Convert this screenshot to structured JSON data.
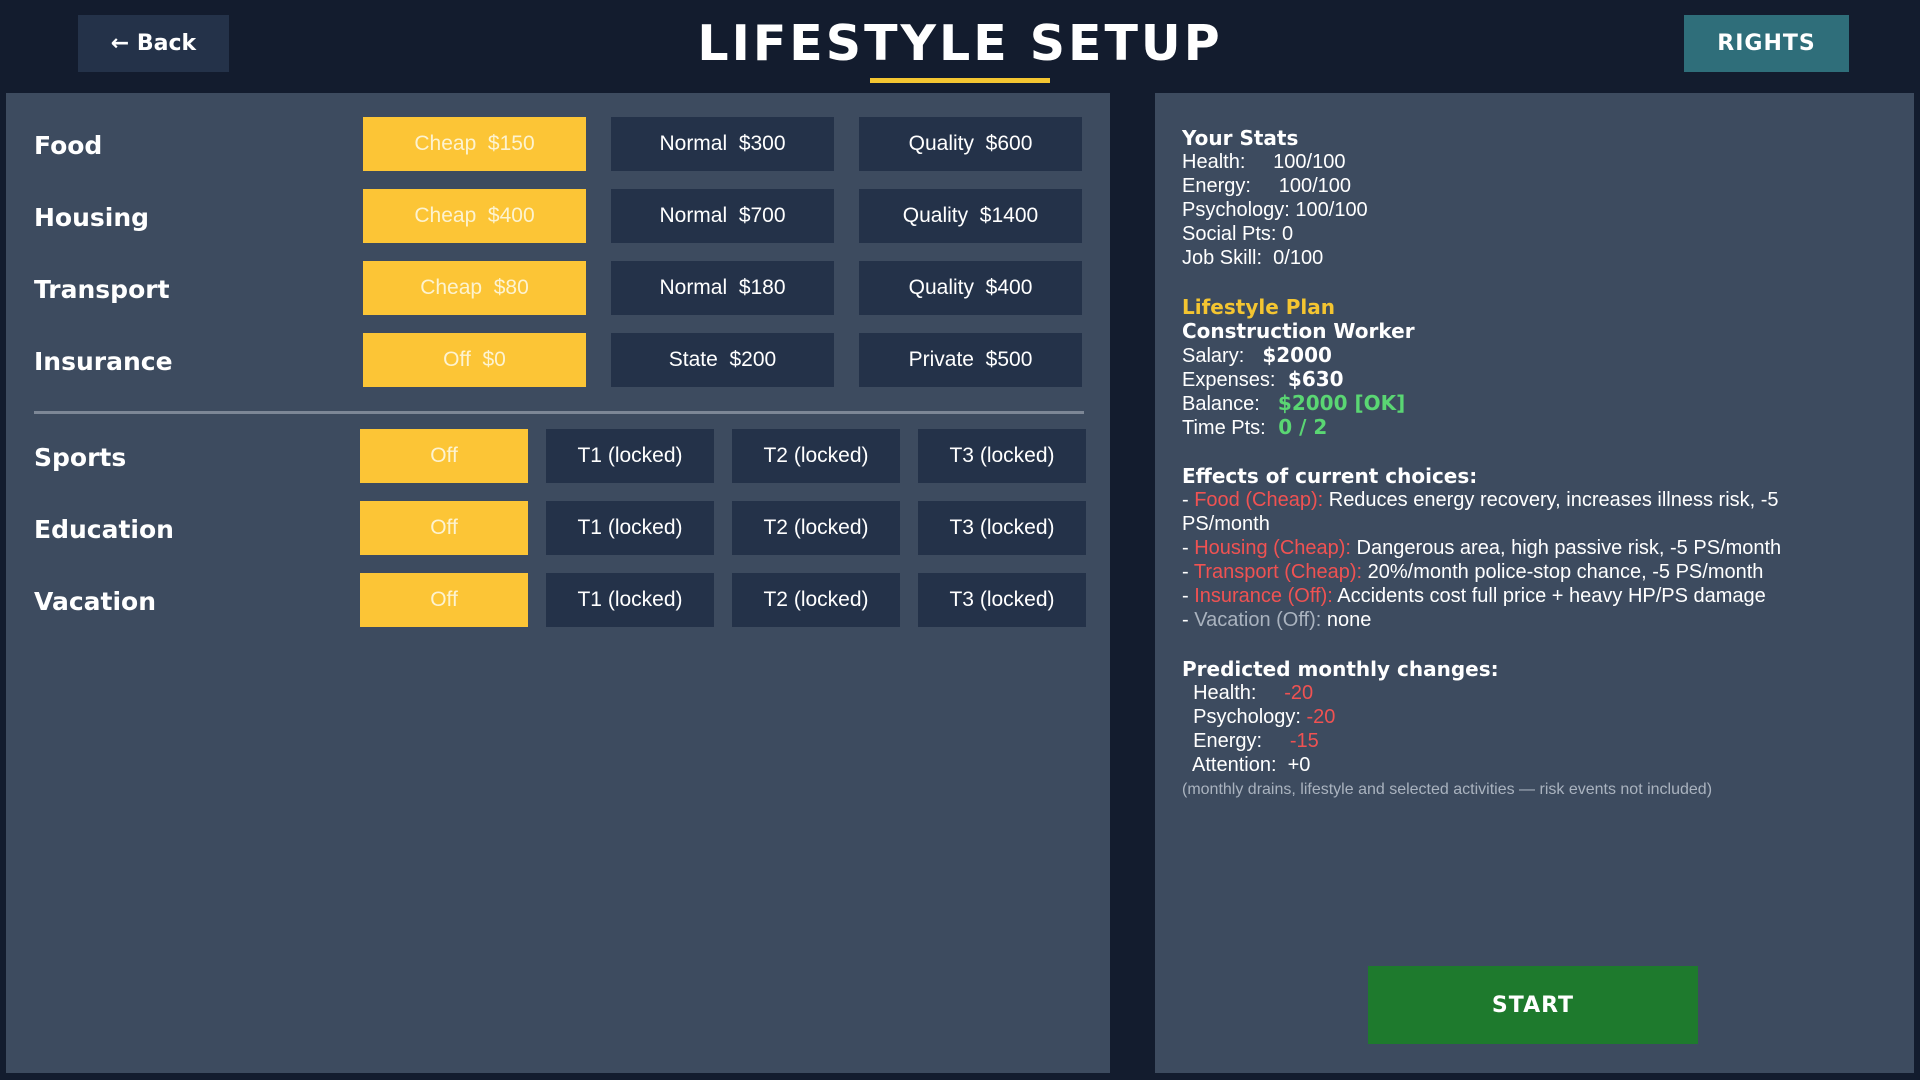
{
  "header": {
    "back_label": "← Back",
    "title": "LIFESTYLE SETUP",
    "rights_label": "RIGHTS"
  },
  "colors": {
    "background": "#131c2e",
    "panel": "#3d4b5f",
    "button": "#243249",
    "selected": "#fcc536",
    "accent": "#f4c531",
    "rights": "#2f6e7a",
    "start": "#1e7a2d",
    "negative": "#f05252",
    "positive": "#5ad673"
  },
  "lifestyle": {
    "food": {
      "label": "Food",
      "options": [
        {
          "label": "Cheap  $150",
          "selected": true
        },
        {
          "label": "Normal  $300",
          "selected": false
        },
        {
          "label": "Quality  $600",
          "selected": false
        }
      ]
    },
    "housing": {
      "label": "Housing",
      "options": [
        {
          "label": "Cheap  $400",
          "selected": true
        },
        {
          "label": "Normal  $700",
          "selected": false
        },
        {
          "label": "Quality  $1400",
          "selected": false
        }
      ]
    },
    "transport": {
      "label": "Transport",
      "options": [
        {
          "label": "Cheap  $80",
          "selected": true
        },
        {
          "label": "Normal  $180",
          "selected": false
        },
        {
          "label": "Quality  $400",
          "selected": false
        }
      ]
    },
    "insurance": {
      "label": "Insurance",
      "options": [
        {
          "label": "Off  $0",
          "selected": true
        },
        {
          "label": "State  $200",
          "selected": false
        },
        {
          "label": "Private  $500",
          "selected": false
        }
      ]
    }
  },
  "activities": {
    "sports": {
      "label": "Sports",
      "options": [
        {
          "label": "Off",
          "selected": true
        },
        {
          "label": "T1 (locked)",
          "selected": false
        },
        {
          "label": "T2 (locked)",
          "selected": false
        },
        {
          "label": "T3 (locked)",
          "selected": false
        }
      ]
    },
    "education": {
      "label": "Education",
      "options": [
        {
          "label": "Off",
          "selected": true
        },
        {
          "label": "T1 (locked)",
          "selected": false
        },
        {
          "label": "T2 (locked)",
          "selected": false
        },
        {
          "label": "T3 (locked)",
          "selected": false
        }
      ]
    },
    "vacation": {
      "label": "Vacation",
      "options": [
        {
          "label": "Off",
          "selected": true
        },
        {
          "label": "T1 (locked)",
          "selected": false
        },
        {
          "label": "T2 (locked)",
          "selected": false
        },
        {
          "label": "T3 (locked)",
          "selected": false
        }
      ]
    }
  },
  "stats": {
    "heading": "Your Stats",
    "health": "Health:     100/100",
    "energy": "Energy:     100/100",
    "psychology": "Psychology: 100/100",
    "social": "Social Pts: 0",
    "job_skill": "Job Skill:  0/100"
  },
  "plan": {
    "heading": "Lifestyle Plan",
    "job": "Construction Worker",
    "salary_label": "Salary:  ",
    "salary_value": " $2000",
    "expenses_label": "Expenses: ",
    "expenses_value": " $630",
    "balance_label": "Balance:  ",
    "balance_value": " $2000 [OK]",
    "time_label": "Time Pts: ",
    "time_value": " 0 / 2"
  },
  "effects": {
    "heading": "Effects of current choices:",
    "items": [
      {
        "prefix": "- ",
        "key": "Food (Cheap):",
        "text": " Reduces energy recovery, increases illness risk, -5",
        "text2": "PS/month"
      },
      {
        "prefix": "- ",
        "key": "Housing (Cheap):",
        "text": " Dangerous area, high passive risk, -5 PS/month"
      },
      {
        "prefix": "- ",
        "key": "Transport (Cheap):",
        "text": " 20%/month police-stop chance, -5 PS/month"
      },
      {
        "prefix": "- ",
        "key": "Insurance (Off):",
        "text": " Accidents cost full price + heavy HP/PS damage"
      },
      {
        "prefix": "- ",
        "key": "Vacation (Off):",
        "text": " none"
      }
    ]
  },
  "predicted": {
    "heading": "Predicted monthly changes:",
    "health_label": "  Health:     ",
    "health_value": "-20",
    "psychology_label": "  Psychology: ",
    "psychology_value": "-20",
    "energy_label": "  Energy:     ",
    "energy_value": "-15",
    "attention_label": "  Attention:  ",
    "attention_value": "+0",
    "note": "(monthly drains, lifestyle and selected activities — risk events not included)"
  },
  "start_label": "START"
}
